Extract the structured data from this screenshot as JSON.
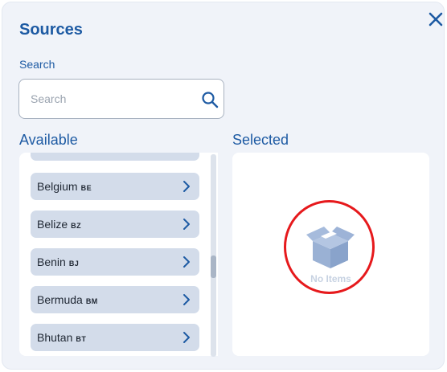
{
  "dialog": {
    "title": "Sources",
    "close_icon": "close-icon"
  },
  "search": {
    "label": "Search",
    "placeholder": "Search",
    "value": "",
    "icon": "search-icon"
  },
  "available": {
    "title": "Available",
    "items": [
      {
        "name": "Belgium",
        "code": "BE"
      },
      {
        "name": "Belize",
        "code": "BZ"
      },
      {
        "name": "Benin",
        "code": "BJ"
      },
      {
        "name": "Bermuda",
        "code": "BM"
      },
      {
        "name": "Bhutan",
        "code": "BT"
      }
    ]
  },
  "selected": {
    "title": "Selected",
    "empty_text": "No Items",
    "empty_icon": "box-icon"
  },
  "colors": {
    "accent": "#1d5aa3",
    "item_bg": "#d3dcea",
    "highlight": "#e6191c"
  }
}
